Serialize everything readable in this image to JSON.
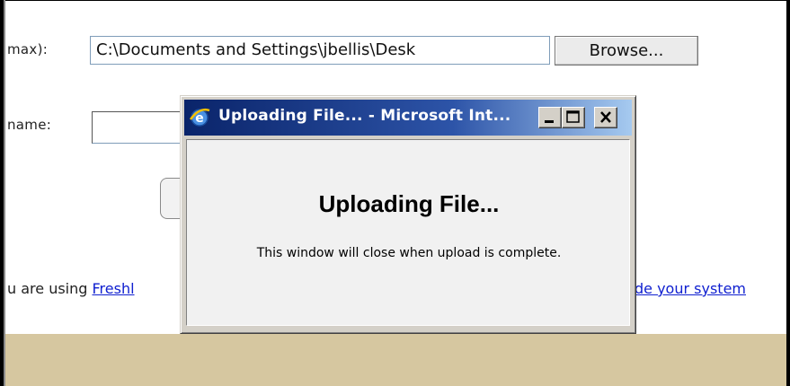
{
  "form": {
    "file_label": "max):",
    "file_value": "C:\\Documents and Settings\\jbellis\\Desk",
    "browse_label": "Browse...",
    "name_label": "name:",
    "name_value": ""
  },
  "info": {
    "prefix": "u are using ",
    "link_text": "Freshl",
    "link_right": "de your system"
  },
  "popup": {
    "title": "Uploading File... - Microsoft Int...",
    "heading": "Uploading File...",
    "message": "This window will close when upload is complete.",
    "icon": "internet-explorer-icon"
  },
  "colors": {
    "title_gradient_start": "#0a246a",
    "title_gradient_end": "#a6caf0",
    "bottom_band": "#d6c7a0",
    "link": "#1020d0"
  }
}
